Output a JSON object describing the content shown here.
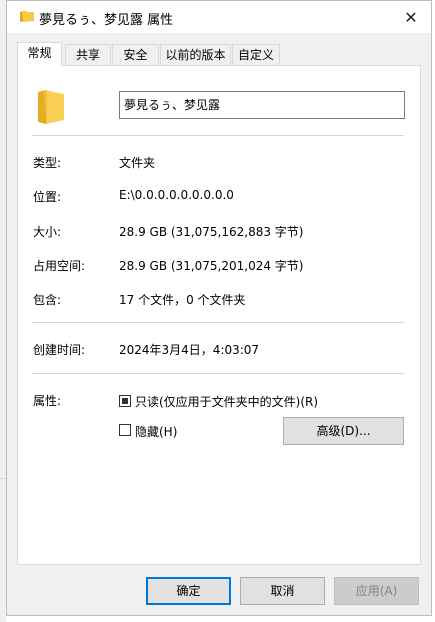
{
  "window": {
    "title": "夢見るぅ、梦见露 属性",
    "close_glyph": "✕"
  },
  "tabs": [
    {
      "label": "常规",
      "active": true
    },
    {
      "label": "共享",
      "active": false
    },
    {
      "label": "安全",
      "active": false
    },
    {
      "label": "以前的版本",
      "active": false
    },
    {
      "label": "自定义",
      "active": false
    }
  ],
  "general": {
    "name_value": "夢見るぅ、梦见露",
    "type_label": "类型:",
    "type_value": "文件夹",
    "location_label": "位置:",
    "location_value": "E:\\0.0.0.0.0.0.0.0.0",
    "size_label": "大小:",
    "size_value": "28.9 GB (31,075,162,883 字节)",
    "size_on_disk_label": "占用空间:",
    "size_on_disk_value": "28.9 GB (31,075,201,024 字节)",
    "contains_label": "包含:",
    "contains_value": "17 个文件，0 个文件夹",
    "created_label": "创建时间:",
    "created_value": "2024年3月4日，4:03:07",
    "attributes_label": "属性:",
    "readonly_label": "只读(仅应用于文件夹中的文件)(R)",
    "readonly_state": "indeterminate",
    "hidden_label": "隐藏(H)",
    "hidden_checked": false,
    "advanced_button": "高级(D)..."
  },
  "buttons": {
    "ok": "确定",
    "cancel": "取消",
    "apply": "应用(A)"
  },
  "colors": {
    "folder": "#f7c948",
    "accent": "#0078d7"
  },
  "icons": {
    "title_icon": "folder-icon",
    "big_icon": "folder-icon"
  }
}
